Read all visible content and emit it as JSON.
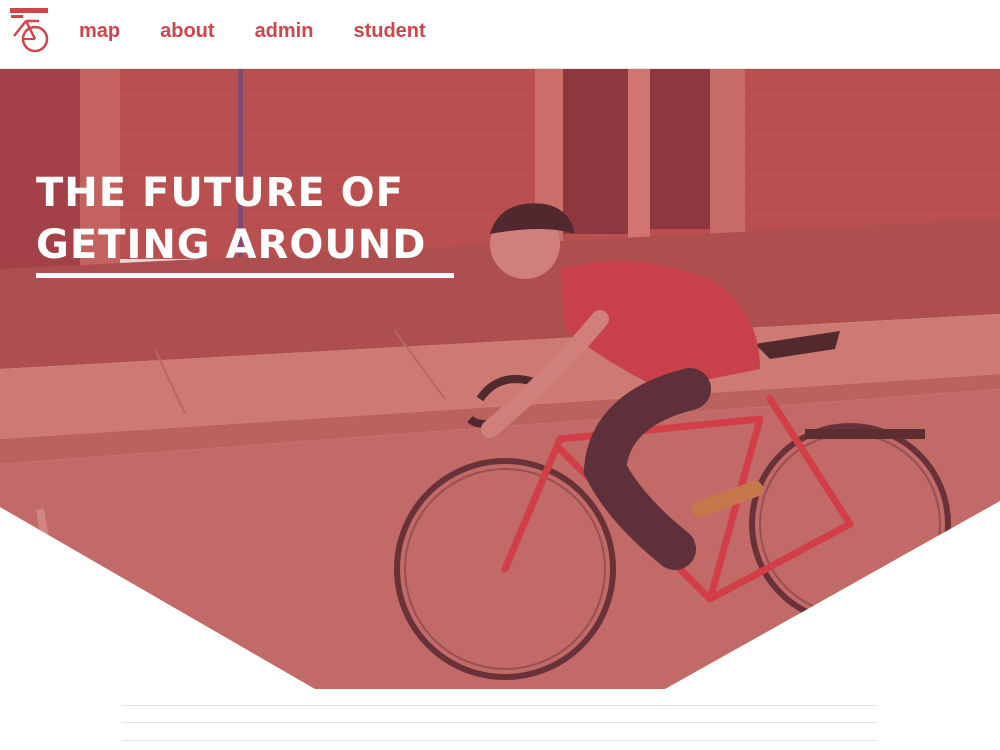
{
  "nav": {
    "logo_icon": "bicycle-logo-icon",
    "links": [
      {
        "label": "map"
      },
      {
        "label": "about"
      },
      {
        "label": "admin"
      },
      {
        "label": "student"
      }
    ]
  },
  "hero": {
    "title_line1": "THE FUTURE OF",
    "title_line2": "GETING AROUND",
    "image": "cyclist-on-street-photo"
  },
  "colors": {
    "accent": "#d0454b",
    "overlay": "#c24a4f",
    "background": "#ffffff"
  }
}
